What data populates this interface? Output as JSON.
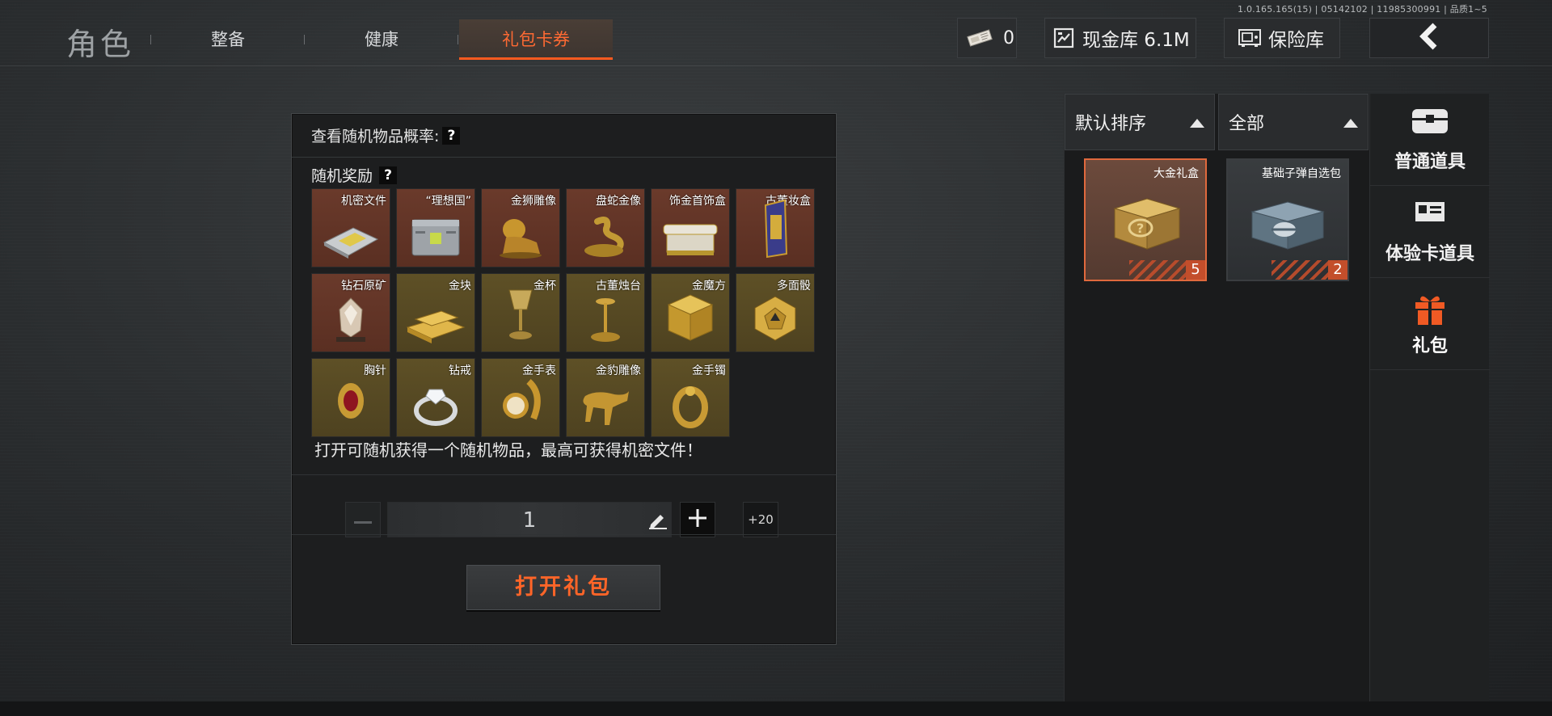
{
  "version": "1.0.165.165(15) | 05142102 | 11985300991 | 品质1~5",
  "header": {
    "title": "角色",
    "tabs": [
      {
        "label": "整备",
        "active": false
      },
      {
        "label": "健康",
        "active": false
      },
      {
        "label": "礼包卡券",
        "active": true
      }
    ],
    "ticket_count": "0",
    "cash_label": "现金库 6.1M",
    "safe_label": "保险库",
    "accent_color": "#ff5a1f"
  },
  "panel": {
    "probability_label": "查看随机物品概率:",
    "rewards_label": "随机奖励",
    "help_glyph": "?",
    "rewards": [
      {
        "name": "机密文件",
        "tier": "red",
        "icon": "document-case-icon"
      },
      {
        "name": "“理想国”",
        "tier": "red",
        "icon": "metal-crate-icon"
      },
      {
        "name": "金狮雕像",
        "tier": "red",
        "icon": "lion-statue-icon"
      },
      {
        "name": "盘蛇金像",
        "tier": "red",
        "icon": "snake-statue-icon"
      },
      {
        "name": "饰金首饰盒",
        "tier": "red",
        "icon": "jewelry-box-icon"
      },
      {
        "name": "古董妆盒",
        "tier": "red",
        "icon": "antique-case-icon"
      },
      {
        "name": "钻石原矿",
        "tier": "red",
        "icon": "raw-diamond-icon"
      },
      {
        "name": "金块",
        "tier": "gold",
        "icon": "gold-bar-icon"
      },
      {
        "name": "金杯",
        "tier": "gold",
        "icon": "gold-cup-icon"
      },
      {
        "name": "古董烛台",
        "tier": "gold",
        "icon": "candlestick-icon"
      },
      {
        "name": "金魔方",
        "tier": "gold",
        "icon": "gold-cube-icon"
      },
      {
        "name": "多面骰",
        "tier": "gold",
        "icon": "polyhedral-dice-icon"
      },
      {
        "name": "胸针",
        "tier": "gold",
        "icon": "brooch-icon"
      },
      {
        "name": "钻戒",
        "tier": "gold",
        "icon": "diamond-ring-icon"
      },
      {
        "name": "金手表",
        "tier": "gold",
        "icon": "gold-watch-icon"
      },
      {
        "name": "金豹雕像",
        "tier": "gold",
        "icon": "leopard-statue-icon"
      },
      {
        "name": "金手镯",
        "tier": "gold",
        "icon": "gold-bracelet-icon"
      }
    ],
    "description": "打开可随机获得一个随机物品，最高可获得机密文件！",
    "quantity": "1",
    "plus20_label": "+20",
    "open_button_label": "打开礼包"
  },
  "inventory": {
    "sort_label": "默认排序",
    "filter_label": "全部",
    "items": [
      {
        "name": "大金礼盒",
        "count": "5",
        "selected": true,
        "icon": "gold-gift-box-icon"
      },
      {
        "name": "基础子弹自选包",
        "count": "2",
        "selected": false,
        "icon": "ammo-box-icon"
      }
    ],
    "categories": [
      {
        "label": "普通道具",
        "icon": "chest-icon",
        "active": false
      },
      {
        "label": "体验卡道具",
        "icon": "id-card-icon",
        "active": false
      },
      {
        "label": "礼包",
        "icon": "gift-icon",
        "active": true
      }
    ]
  }
}
